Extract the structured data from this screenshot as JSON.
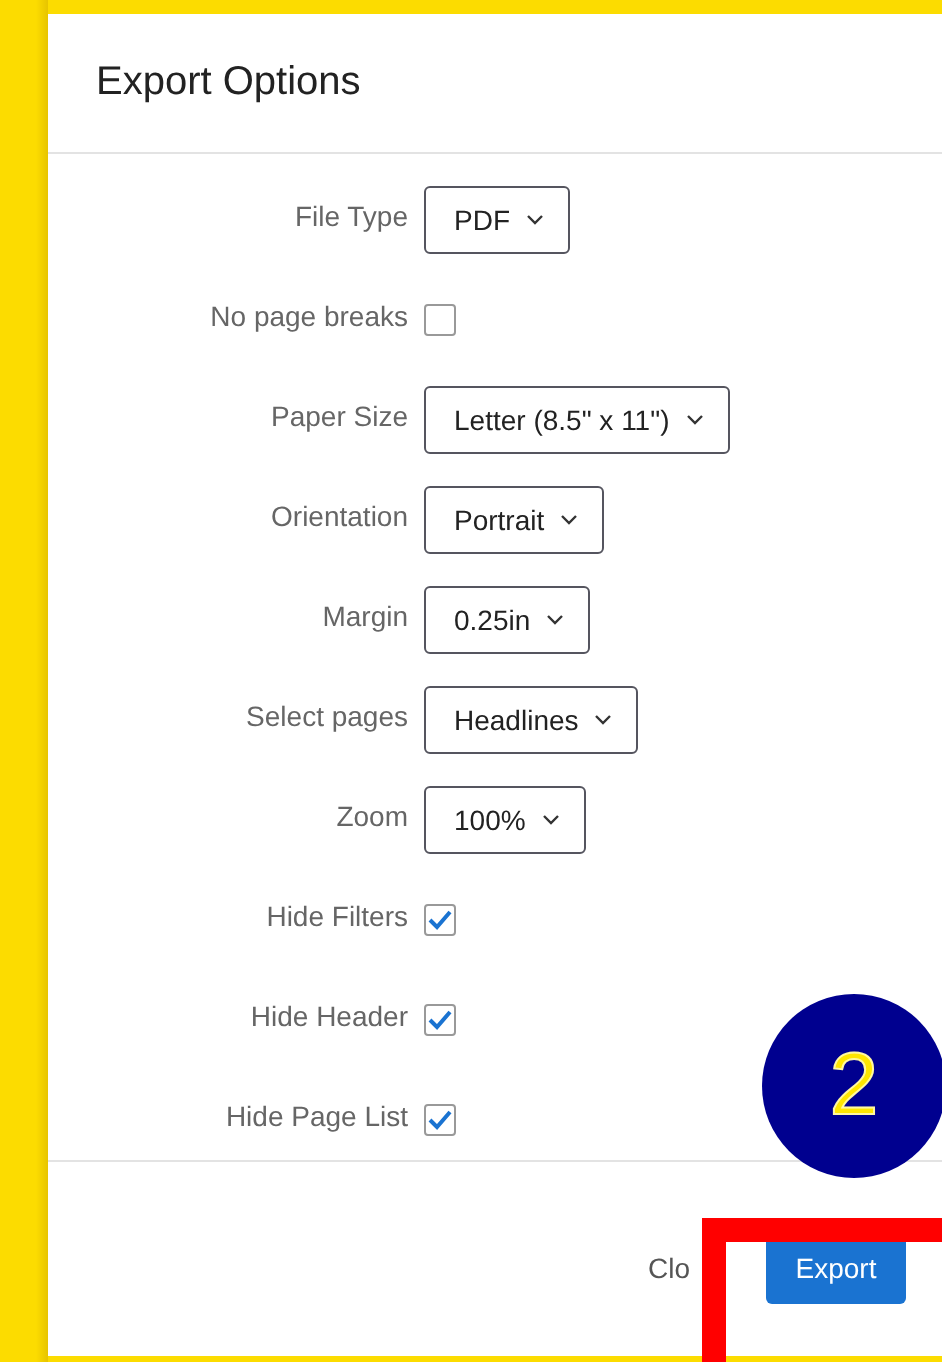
{
  "dialog": {
    "title": "Export Options",
    "fields": [
      {
        "kind": "select",
        "label": "File Type",
        "value": "PDF"
      },
      {
        "kind": "checkbox",
        "label": "No page breaks",
        "checked": false
      },
      {
        "kind": "select",
        "label": "Paper Size",
        "value": "Letter (8.5\" x 11\")"
      },
      {
        "kind": "select",
        "label": "Orientation",
        "value": "Portrait"
      },
      {
        "kind": "select",
        "label": "Margin",
        "value": "0.25in"
      },
      {
        "kind": "select",
        "label": "Select pages",
        "value": "Headlines"
      },
      {
        "kind": "select",
        "label": "Zoom",
        "value": "100%"
      },
      {
        "kind": "checkbox",
        "label": "Hide Filters",
        "checked": true
      },
      {
        "kind": "checkbox",
        "label": "Hide Header",
        "checked": true
      },
      {
        "kind": "checkbox",
        "label": "Hide Page List",
        "checked": true
      }
    ],
    "buttons": [
      {
        "kind": "link",
        "label": "Clo"
      },
      {
        "kind": "primary",
        "label": "Export"
      }
    ]
  },
  "step_badge": "2"
}
